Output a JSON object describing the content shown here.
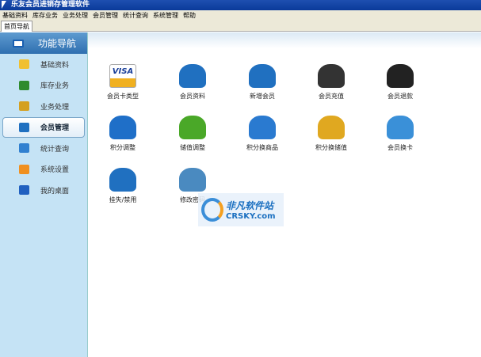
{
  "window": {
    "title": "乐友会员进销存管理软件"
  },
  "menu": [
    "基础资料",
    "库存业务",
    "业务处理",
    "会员管理",
    "统计查询",
    "系统管理",
    "帮助"
  ],
  "tabs": [
    "首页导航"
  ],
  "sidebar": {
    "header": "功能导航",
    "items": [
      {
        "label": "基础资料",
        "icon": "pencil-icon",
        "color": "#f0c030"
      },
      {
        "label": "库存业务",
        "icon": "house-icon",
        "color": "#2e8b2e"
      },
      {
        "label": "业务处理",
        "icon": "cart-icon",
        "color": "#d4a020"
      },
      {
        "label": "会员管理",
        "icon": "users-icon",
        "color": "#2070c0",
        "selected": true
      },
      {
        "label": "统计查询",
        "icon": "bar-chart-icon",
        "color": "#3080d0"
      },
      {
        "label": "系统设置",
        "icon": "gear-icon",
        "color": "#f09020"
      },
      {
        "label": "我的桌面",
        "icon": "monitor-icon",
        "color": "#2060c0"
      }
    ]
  },
  "tiles": [
    {
      "label": "会员卡类型",
      "icon": "visa-card-icon",
      "color": "#1a3f9a"
    },
    {
      "label": "会员资料",
      "icon": "users-icon",
      "color": "#2070c0"
    },
    {
      "label": "新增会员",
      "icon": "add-user-icon",
      "color": "#2070c0"
    },
    {
      "label": "会员充值",
      "icon": "businessman-money-icon",
      "color": "#333333"
    },
    {
      "label": "会员退款",
      "icon": "woman-refund-icon",
      "color": "#222222"
    },
    {
      "label": "积分调整",
      "icon": "blue-refresh-icon",
      "color": "#1f6fc8"
    },
    {
      "label": "储值调整",
      "icon": "green-refresh-icon",
      "color": "#4aa828"
    },
    {
      "label": "积分换商品",
      "icon": "gift-icon",
      "color": "#2a7ad0"
    },
    {
      "label": "积分换储值",
      "icon": "coins-icon",
      "color": "#e0a820"
    },
    {
      "label": "会员换卡",
      "icon": "credit-card-icon",
      "color": "#3a90d8"
    },
    {
      "label": "挂失/禁用",
      "icon": "user-disable-icon",
      "color": "#2070c0"
    },
    {
      "label": "修改密码",
      "icon": "key-icon",
      "color": "#4a8ac0"
    }
  ],
  "watermark": {
    "cn": "非凡软件站",
    "en": "CRSKY.com"
  }
}
